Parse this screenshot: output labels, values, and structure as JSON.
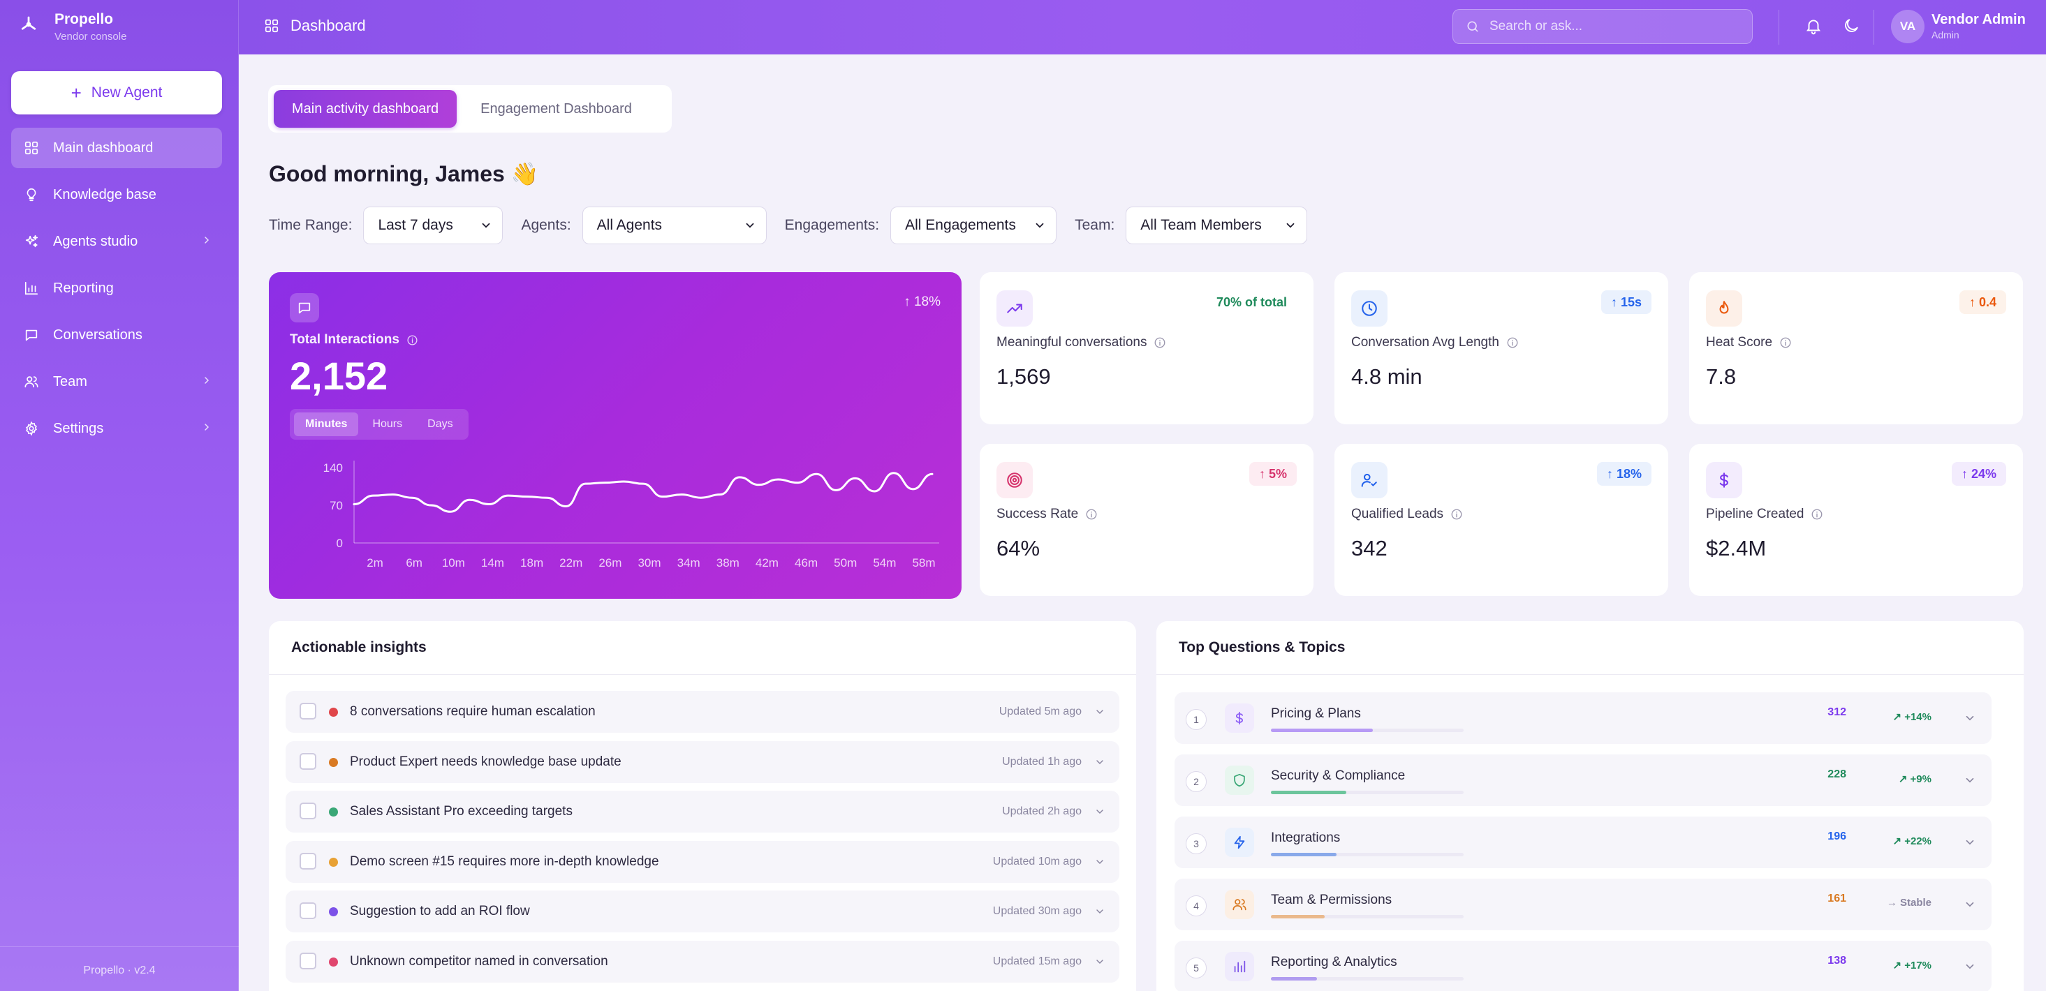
{
  "app": {
    "name": "Propello",
    "subtitle": "Vendor console",
    "version": "Propello · v2.4"
  },
  "header": {
    "title": "Dashboard",
    "search_placeholder": "Search or ask..."
  },
  "user": {
    "initials": "VA",
    "name": "Vendor Admin",
    "role": "Admin"
  },
  "sidebar": {
    "new_agent_label": "New Agent",
    "items": [
      {
        "label": "Main dashboard",
        "icon": "grid-icon",
        "active": true
      },
      {
        "label": "Knowledge base",
        "icon": "lightbulb-icon"
      },
      {
        "label": "Agents studio",
        "icon": "sparkles-icon",
        "chevron": true
      },
      {
        "label": "Reporting",
        "icon": "bar-chart-icon"
      },
      {
        "label": "Conversations",
        "icon": "chat-icon"
      },
      {
        "label": "Team",
        "icon": "users-icon",
        "chevron": true
      },
      {
        "label": "Settings",
        "icon": "gear-icon",
        "chevron": true
      }
    ]
  },
  "tabs": [
    {
      "label": "Main activity dashboard",
      "active": true
    },
    {
      "label": "Engagement Dashboard"
    }
  ],
  "greeting": "Good morning, James 👋",
  "filters": [
    {
      "label": "Time Range:",
      "value": "Last 7 days"
    },
    {
      "label": "Agents:",
      "value": "All Agents"
    },
    {
      "label": "Engagements:",
      "value": "All Engagements"
    },
    {
      "label": "Team:",
      "value": "All Team Members"
    }
  ],
  "hero": {
    "label": "Total Interactions",
    "value": "2,152",
    "change": "↑ 18%",
    "segments": [
      "Minutes",
      "Hours",
      "Days"
    ],
    "active_segment": "Minutes"
  },
  "chart_data": {
    "type": "line",
    "x": [
      "2m",
      "6m",
      "10m",
      "14m",
      "18m",
      "22m",
      "26m",
      "30m",
      "34m",
      "38m",
      "42m",
      "46m",
      "50m",
      "54m",
      "58m"
    ],
    "x_ticks": [
      "2m",
      "6m",
      "10m",
      "14m",
      "18m",
      "22m",
      "26m",
      "30m",
      "34m",
      "38m",
      "42m",
      "46m",
      "50m",
      "54m",
      "58m"
    ],
    "y_ticks": [
      "0",
      "70",
      "140"
    ],
    "ylim": [
      0,
      140
    ],
    "series": [
      {
        "values": [
          72,
          88,
          90,
          84,
          70,
          58,
          80,
          72,
          88,
          86,
          84,
          68,
          110,
          112,
          114,
          110,
          86,
          90,
          84,
          90,
          122,
          108,
          118,
          112,
          128,
          98,
          120,
          96,
          130,
          100,
          128
        ]
      }
    ]
  },
  "stats": [
    {
      "label": "Meaningful conversations",
      "value": "1,569",
      "badge": "70% of total",
      "icon": "trend-up-icon",
      "accent": "#7c3aed",
      "icon_bg": "#f3ecfd",
      "badge_color": "#1f8a5b",
      "badge_bg": "#ffffff"
    },
    {
      "label": "Conversation Avg Length",
      "value": "4.8 min",
      "badge": "↑ 15s",
      "icon": "clock-icon",
      "accent": "#2563eb",
      "icon_bg": "#eaf1fd",
      "badge_color": "#2563eb",
      "badge_bg": "#eaf1fd"
    },
    {
      "label": "Heat Score",
      "value": "7.8",
      "badge": "↑ 0.4",
      "icon": "flame-icon",
      "accent": "#ea580c",
      "icon_bg": "#fdf0e8",
      "badge_color": "#ea580c",
      "badge_bg": "#fdf2ea"
    },
    {
      "label": "Success Rate",
      "value": "64%",
      "badge": "↑ 5%",
      "icon": "target-icon",
      "accent": "#d6336c",
      "icon_bg": "#fdecf2",
      "badge_color": "#d6336c",
      "badge_bg": "#fdecf2"
    },
    {
      "label": "Qualified Leads",
      "value": "342",
      "badge": "↑ 18%",
      "icon": "user-check-icon",
      "accent": "#2563eb",
      "icon_bg": "#eaf1fd",
      "badge_color": "#2563eb",
      "badge_bg": "#eaf1fd"
    },
    {
      "label": "Pipeline Created",
      "value": "$2.4M",
      "badge": "↑ 24%",
      "icon": "dollar-icon",
      "accent": "#7c3aed",
      "icon_bg": "#f3ecfd",
      "badge_color": "#7c3aed",
      "badge_bg": "#f3ecfd"
    }
  ],
  "insights": {
    "title": "Actionable insights",
    "items": [
      {
        "text": "8 conversations require human escalation",
        "updated": "Updated 5m ago",
        "color": "#e0464a"
      },
      {
        "text": "Product Expert needs knowledge base update",
        "updated": "Updated 1h ago",
        "color": "#d97a23"
      },
      {
        "text": "Sales Assistant Pro exceeding targets",
        "updated": "Updated 2h ago",
        "color": "#3aa776"
      },
      {
        "text": "Demo screen #15 requires more in-depth knowledge",
        "updated": "Updated 10m ago",
        "color": "#e8a134"
      },
      {
        "text": "Suggestion to add an ROI flow",
        "updated": "Updated 30m ago",
        "color": "#7c52e8"
      },
      {
        "text": "Unknown competitor named in conversation",
        "updated": "Updated 15m ago",
        "color": "#e0466e"
      }
    ]
  },
  "topics": {
    "title": "Top Questions & Topics",
    "items": [
      {
        "rank": "1",
        "name": "Pricing & Plans",
        "count": "312",
        "trend": "↗ +14%",
        "icon": "dollar-icon",
        "accent": "#8b5cf6",
        "icon_bg": "#f1ebfd",
        "bar_color": "#b79af5",
        "share": 0.53,
        "count_color": "#7c3aed",
        "trend_color": "#1f8a5b"
      },
      {
        "rank": "2",
        "name": "Security & Compliance",
        "count": "228",
        "trend": "↗ +9%",
        "icon": "shield-icon",
        "accent": "#3aa776",
        "icon_bg": "#e8f6ef",
        "bar_color": "#6cc59c",
        "share": 0.39,
        "count_color": "#1f8a5b",
        "trend_color": "#1f8a5b"
      },
      {
        "rank": "3",
        "name": "Integrations",
        "count": "196",
        "trend": "↗ +22%",
        "icon": "bolt-icon",
        "accent": "#2563eb",
        "icon_bg": "#eaf1fd",
        "bar_color": "#89a9ea",
        "share": 0.34,
        "count_color": "#2563eb",
        "trend_color": "#1f8a5b"
      },
      {
        "rank": "4",
        "name": "Team & Permissions",
        "count": "161",
        "trend": "→ Stable",
        "icon": "users-icon",
        "accent": "#d97a23",
        "icon_bg": "#fcefe4",
        "bar_color": "#eab98c",
        "share": 0.28,
        "count_color": "#d97a23",
        "trend_color": "#8a86a0"
      },
      {
        "rank": "5",
        "name": "Reporting & Analytics",
        "count": "138",
        "trend": "↗ +17%",
        "icon": "bar-chart-icon",
        "accent": "#7c52e8",
        "icon_bg": "#efebfc",
        "bar_color": "#b09cf0",
        "share": 0.24,
        "count_color": "#7c3aed",
        "trend_color": "#1f8a5b"
      }
    ]
  }
}
